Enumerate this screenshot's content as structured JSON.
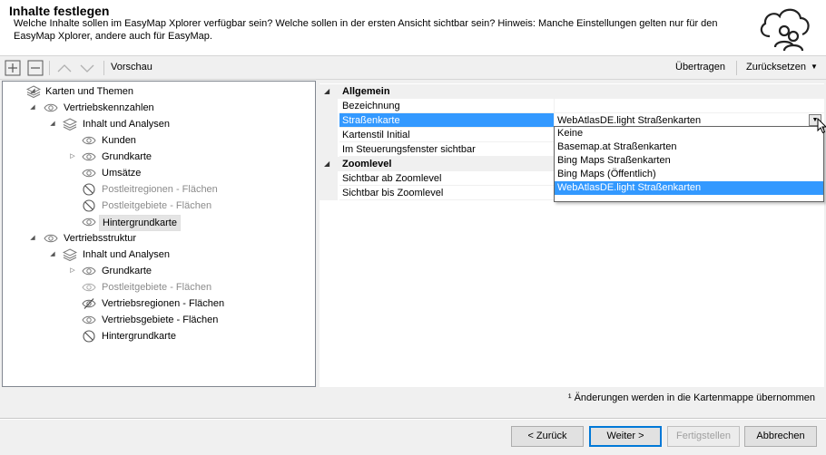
{
  "header": {
    "title": "Inhalte festlegen",
    "description": "Welche Inhalte sollen im EasyMap Xplorer verfügbar sein? Welche sollen in der ersten Ansicht sichtbar sein? Hinweis: Manche Einstellungen gelten nur für den EasyMap Xplorer, andere auch für EasyMap.",
    "logo_icon": "cloud-users-icon"
  },
  "toolbar": {
    "expand_icon": "expand-all-icon",
    "collapse_icon": "collapse-all-icon",
    "up_icon": "move-up-icon",
    "down_icon": "move-down-icon",
    "preview_label": "Vorschau",
    "apply_label": "Übertragen",
    "reset_label": "Zurücksetzen"
  },
  "tree": {
    "items": [
      {
        "label": "Karten und Themen",
        "state": "normal"
      },
      {
        "label": "Vertriebskennzahlen",
        "state": "normal"
      },
      {
        "label": "Inhalt und Analysen",
        "state": "normal"
      },
      {
        "label": "Kunden",
        "state": "normal"
      },
      {
        "label": "Grundkarte",
        "state": "normal"
      },
      {
        "label": "Umsätze",
        "state": "normal"
      },
      {
        "label": "Postleitregionen - Flächen",
        "state": "disabled"
      },
      {
        "label": "Postleitgebiete - Flächen",
        "state": "disabled"
      },
      {
        "label": "Hintergrundkarte",
        "state": "selected"
      },
      {
        "label": "Vertriebsstruktur",
        "state": "normal"
      },
      {
        "label": "Inhalt und Analysen",
        "state": "normal"
      },
      {
        "label": "Grundkarte",
        "state": "normal"
      },
      {
        "label": "Postleitgebiete - Flächen",
        "state": "disabled"
      },
      {
        "label": "Vertriebsregionen - Flächen",
        "state": "normal"
      },
      {
        "label": "Vertriebsgebiete - Flächen",
        "state": "normal"
      },
      {
        "label": "Hintergrundkarte",
        "state": "normal"
      }
    ]
  },
  "properties": {
    "cat_general": "Allgemein",
    "rows_general": [
      {
        "name": "Bezeichnung",
        "value": ""
      },
      {
        "name": "Straßenkarte",
        "value": "WebAtlasDE.light Straßenkarten"
      },
      {
        "name": "Kartenstil Initial",
        "value": ""
      },
      {
        "name": "Im Steuerungsfenster sichtbar",
        "value": ""
      }
    ],
    "cat_zoom": "Zoomlevel",
    "rows_zoom": [
      {
        "name": "Sichtbar ab Zoomlevel",
        "value": ""
      },
      {
        "name": "Sichtbar bis Zoomlevel",
        "value": ""
      }
    ],
    "dropdown_options": [
      "Keine",
      "Basemap.at Straßenkarten",
      "Bing Maps Straßenkarten",
      "Bing Maps (Öffentlich)",
      "WebAtlasDE.light Straßenkarten"
    ],
    "dropdown_selected": "WebAtlasDE.light Straßenkarten"
  },
  "footnote": "¹ Änderungen werden in die Kartenmappe übernommen",
  "buttons": {
    "back": "< Zurück",
    "next": "Weiter >",
    "finish": "Fertigstellen",
    "cancel": "Abbrechen"
  },
  "colors": {
    "selection": "#3399ff",
    "disabled_text": "#8c8c8c"
  }
}
